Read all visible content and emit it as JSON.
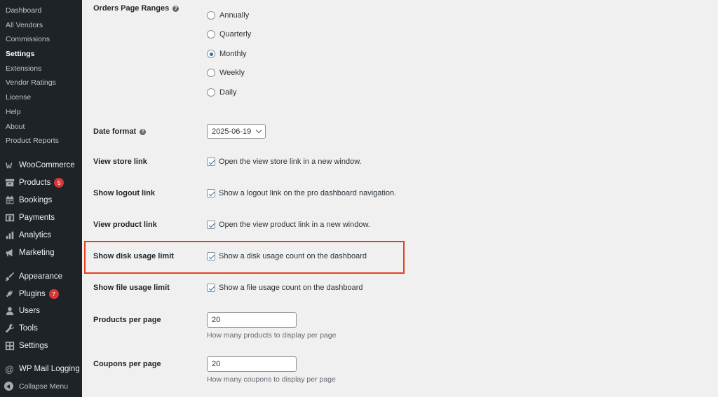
{
  "sidebar": {
    "submenu": [
      {
        "label": "Dashboard"
      },
      {
        "label": "All Vendors"
      },
      {
        "label": "Commissions"
      },
      {
        "label": "Settings"
      },
      {
        "label": "Extensions"
      },
      {
        "label": "Vendor Ratings"
      },
      {
        "label": "License"
      },
      {
        "label": "Help"
      },
      {
        "label": "About"
      },
      {
        "label": "Product Reports"
      }
    ],
    "menu": [
      {
        "label": "WooCommerce",
        "icon": "woocommerce-icon"
      },
      {
        "label": "Products",
        "icon": "archive-icon",
        "badge": "5"
      },
      {
        "label": "Bookings",
        "icon": "calendar-icon"
      },
      {
        "label": "Payments",
        "icon": "dollar-icon"
      },
      {
        "label": "Analytics",
        "icon": "bar-chart-icon"
      },
      {
        "label": "Marketing",
        "icon": "megaphone-icon"
      },
      {
        "label": "Appearance",
        "icon": "paintbrush-icon"
      },
      {
        "label": "Plugins",
        "icon": "plug-icon",
        "badge": "7"
      },
      {
        "label": "Users",
        "icon": "user-icon"
      },
      {
        "label": "Tools",
        "icon": "wrench-icon"
      },
      {
        "label": "Settings",
        "icon": "settings-icon"
      },
      {
        "label": "WP Mail Logging",
        "icon": "at-sign-icon"
      }
    ],
    "collapse_label": "Collapse Menu"
  },
  "settings": {
    "orders_page_ranges": {
      "label": "Orders Page Ranges",
      "options": [
        "Annually",
        "Quarterly",
        "Monthly",
        "Weekly",
        "Daily"
      ],
      "selected": "Monthly"
    },
    "date_format": {
      "label": "Date format",
      "value": "2025-06-19"
    },
    "view_store_link": {
      "label": "View store link",
      "text": "Open the view store link in a new window.",
      "checked": true
    },
    "show_logout_link": {
      "label": "Show logout link",
      "text": "Show a logout link on the pro dashboard navigation.",
      "checked": true
    },
    "view_product_link": {
      "label": "View product link",
      "text": "Open the view product link in a new window.",
      "checked": true
    },
    "show_disk_usage_limit": {
      "label": "Show disk usage limit",
      "text": "Show a disk usage count on the dashboard",
      "checked": true
    },
    "show_file_usage_limit": {
      "label": "Show file usage limit",
      "text": "Show a file usage count on the dashboard",
      "checked": true
    },
    "products_per_page": {
      "label": "Products per page",
      "value": "20",
      "description": "How many products to display per page"
    },
    "coupons_per_page": {
      "label": "Coupons per page",
      "value": "20",
      "description": "How many coupons to display per page"
    }
  },
  "colors": {
    "sidebar_bg": "#1d2327",
    "accent": "#2271b1",
    "highlight_border": "#e8401c",
    "badge": "#d63638"
  }
}
